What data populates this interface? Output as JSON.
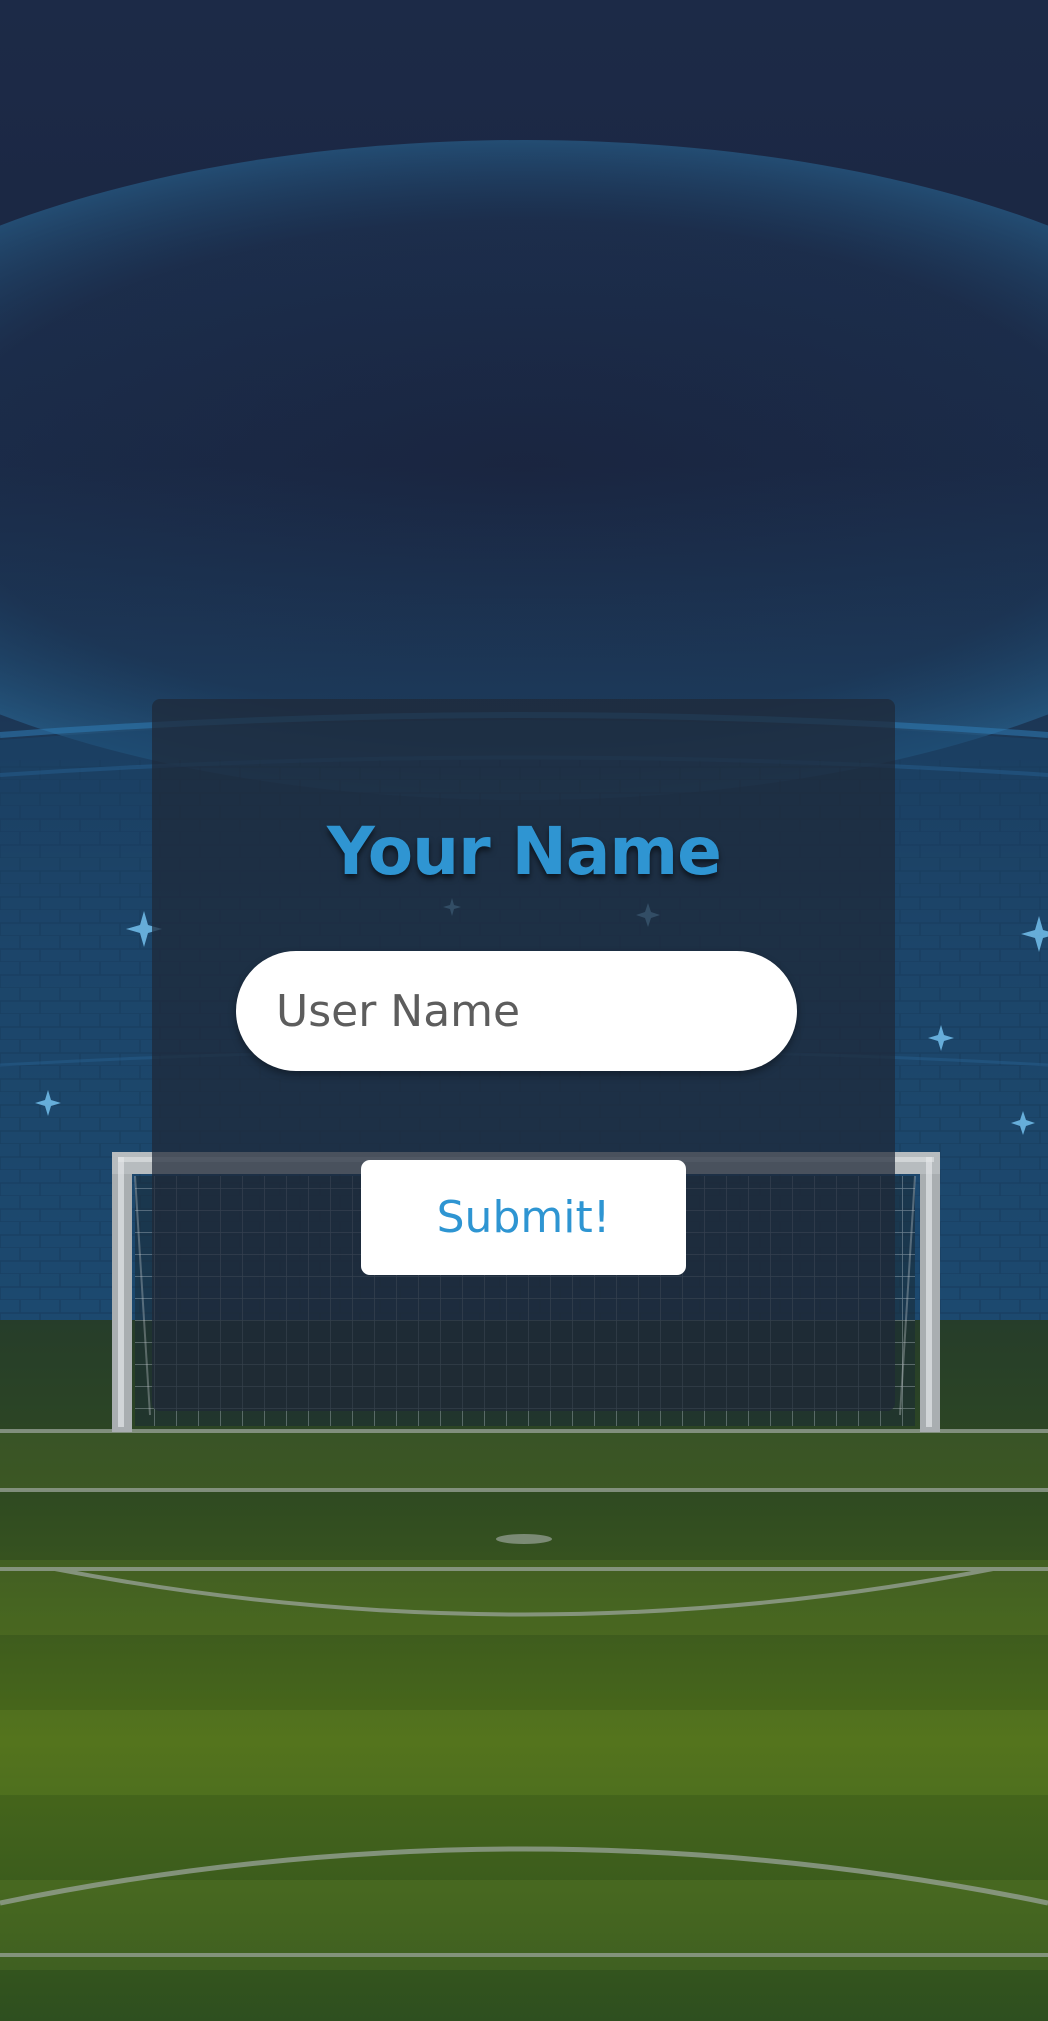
{
  "form": {
    "title": "Your Name",
    "input_placeholder": "User Name",
    "input_value": "",
    "submit_label": "Submit!"
  },
  "colors": {
    "accent": "#2f95d2",
    "sky": "#1b2a45",
    "pitch": "#3f5e1c",
    "panel": "#1e2838",
    "button_bg": "#ffffff"
  }
}
